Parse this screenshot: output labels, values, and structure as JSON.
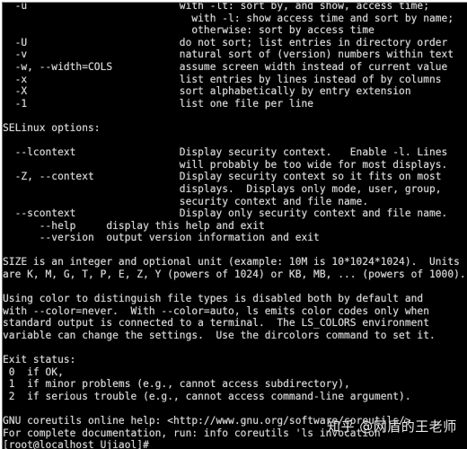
{
  "terminal": {
    "lines": [
      "  -u                         with -lt: sort by, and show, access time;",
      "                               with -l: show access time and sort by name;",
      "                               otherwise: sort by access time",
      "  -U                         do not sort; list entries in directory order",
      "  -v                         natural sort of (version) numbers within text",
      "  -w, --width=COLS           assume screen width instead of current value",
      "  -x                         list entries by lines instead of by columns",
      "  -X                         sort alphabetically by entry extension",
      "  -1                         list one file per line",
      "",
      "SELinux options:",
      "",
      "  --lcontext                 Display security context.   Enable -l. Lines",
      "                             will probably be too wide for most displays.",
      "  -Z, --context              Display security context so it fits on most",
      "                             displays.  Displays only mode, user, group,",
      "                             security context and file name.",
      "  --scontext                 Display only security context and file name.",
      "      --help     display this help and exit",
      "      --version  output version information and exit",
      "",
      "SIZE is an integer and optional unit (example: 10M is 10*1024*1024).  Units",
      "are K, M, G, T, P, E, Z, Y (powers of 1024) or KB, MB, ... (powers of 1000).",
      "",
      "Using color to distinguish file types is disabled both by default and",
      "with --color=never.  With --color=auto, ls emits color codes only when",
      "standard output is connected to a terminal.  The LS_COLORS environment",
      "variable can change the settings.  Use the dircolors command to set it.",
      "",
      "Exit status:",
      " 0  if OK,",
      " 1  if minor problems (e.g., cannot access subdirectory),",
      " 2  if serious trouble (e.g., cannot access command-line argument).",
      "",
      "GNU coreutils online help: <http://www.gnu.org/software/coreutils/>",
      "For complete documentation, run: info coreutils 'ls invocation'",
      "[root@localhost Ujiaol]# "
    ]
  },
  "watermark": {
    "text": "知乎 @网盾的王老师"
  }
}
